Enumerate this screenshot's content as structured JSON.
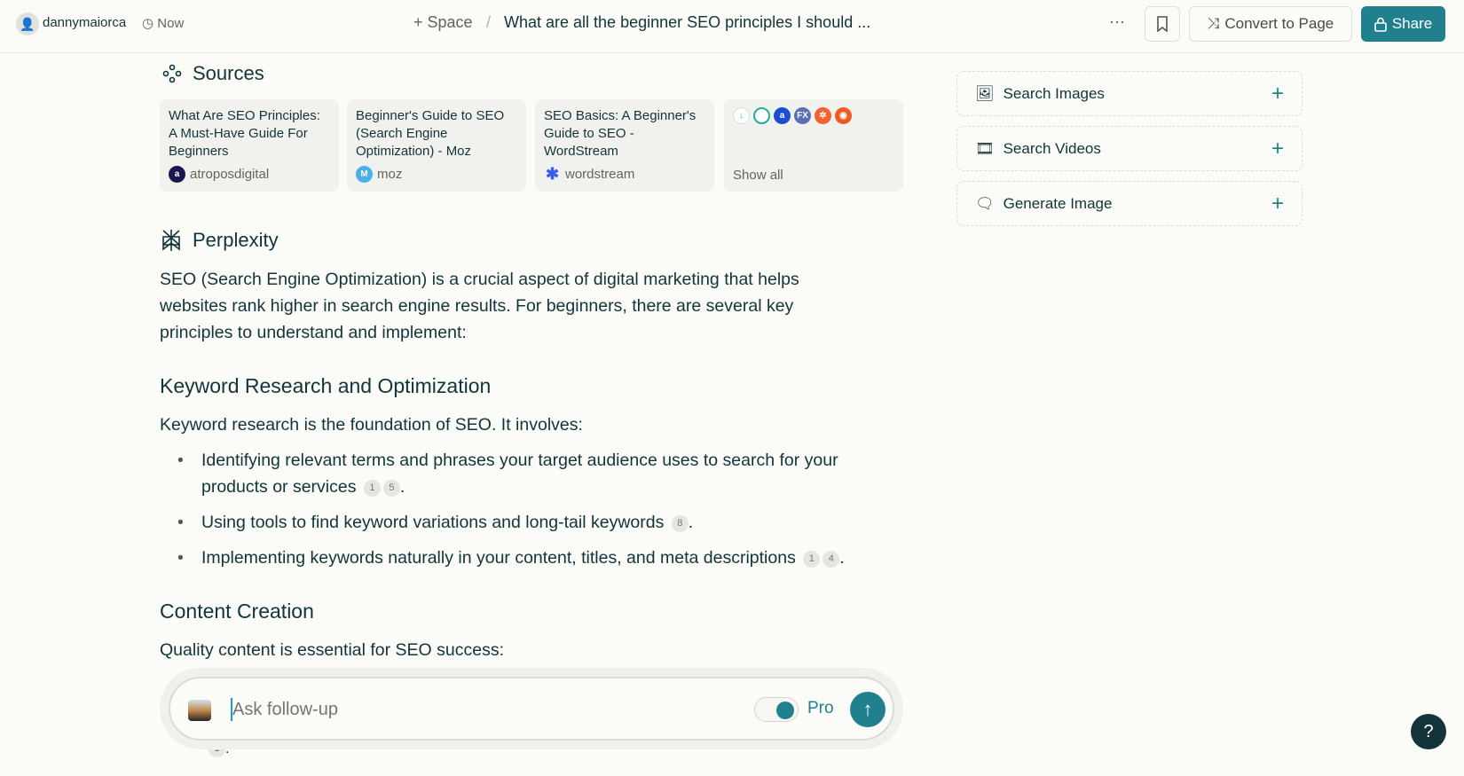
{
  "header": {
    "username": "dannymaiorca",
    "time": "Now",
    "space": "Space",
    "separator": "/",
    "thread_title": "What are all the beginner SEO principles I should ...",
    "more": "···",
    "convert": "Convert to Page",
    "share": "Share"
  },
  "sources": {
    "title": "Sources",
    "cards": [
      {
        "title": "What Are SEO Principles: A Must-Have Guide For Beginners",
        "site": "atroposdigital"
      },
      {
        "title": "Beginner's Guide to SEO (Search Engine Optimization) - Moz",
        "site": "moz"
      },
      {
        "title": "SEO Basics: A Beginner's Guide to SEO - WordStream",
        "site": "wordstream"
      }
    ],
    "show_all": "Show all"
  },
  "right_panel": [
    {
      "label": "Search Images"
    },
    {
      "label": "Search Videos"
    },
    {
      "label": "Generate Image"
    }
  ],
  "answer": {
    "brand": "Perplexity",
    "intro": "SEO (Search Engine Optimization) is a crucial aspect of digital marketing that helps websites rank higher in search engine results. For beginners, there are several key principles to understand and implement:",
    "h1": "Keyword Research and Optimization",
    "p1": "Keyword research is the foundation of SEO. It involves:",
    "bullets": [
      {
        "text": "Identifying relevant terms and phrases your target audience uses to search for your products or services",
        "cites": [
          "1",
          "5"
        ]
      },
      {
        "text": "Using tools to find keyword variations and long-tail keywords",
        "cites": [
          "8"
        ]
      },
      {
        "text": "Implementing keywords naturally in your content, titles, and meta descriptions",
        "cites": [
          "1",
          "4"
        ]
      }
    ],
    "h2": "Content Creation",
    "p2": "Quality content is essential for SEO success:",
    "hidden_cite": "1"
  },
  "input": {
    "placeholder": "Ask follow-up",
    "pro": "Pro",
    "pro_enabled": true
  },
  "help": "?",
  "colors": {
    "accent": "#20808d",
    "text": "#13343b"
  }
}
